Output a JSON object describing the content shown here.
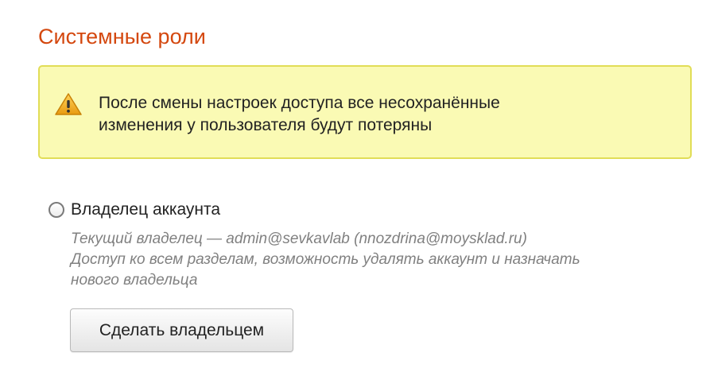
{
  "section": {
    "title": "Системные роли"
  },
  "warning": {
    "icon": "warning-icon",
    "accent_color": "#f0b21a",
    "background": "#fafab4",
    "border": "#e1dd57",
    "line1": "После смены настроек доступа все несохранённые",
    "line2": "изменения у пользователя будут потеряны"
  },
  "owner_option": {
    "label": "Владелец аккаунта",
    "selected": false,
    "description_line1": "Текущий владелец — admin@sevkavlab (nnozdrina@moysklad.ru)",
    "description_line2": "Доступ ко всем разделам, возможность удалять аккаунт и назначать",
    "description_line3": "нового владельца",
    "button_label": "Сделать владельцем"
  },
  "colors": {
    "title": "#d4480f",
    "description": "#808080"
  }
}
